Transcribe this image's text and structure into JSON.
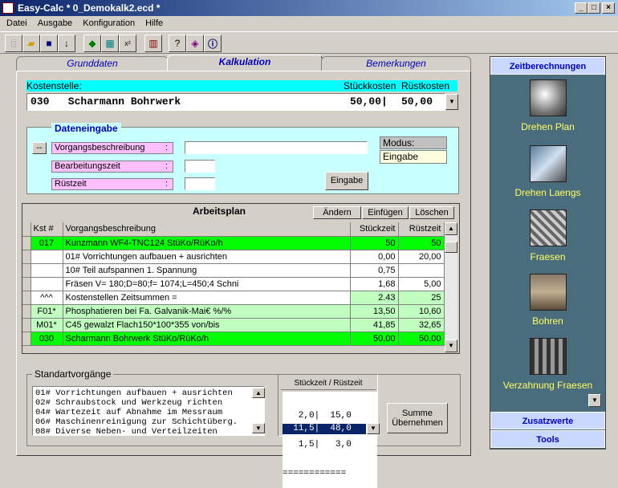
{
  "window": {
    "title": "Easy-Calc * 0_Demokalk2.ecd *",
    "min": "_",
    "max": "□",
    "close": "×"
  },
  "menu": [
    "Datei",
    "Ausgabe",
    "Konfiguration",
    "Hilfe"
  ],
  "toolbar_icons": [
    "new-file-icon",
    "open-folder-icon",
    "save-icon",
    "import-icon",
    "cube-icon",
    "calculator-icon",
    "formula-icon",
    "chart-icon",
    "help-icon",
    "book-icon",
    "info-icon"
  ],
  "tabs": [
    "Grunddaten",
    "Kalkulation",
    "Bemerkungen"
  ],
  "kostenstelle": {
    "label": "Kostenstelle:",
    "col2": "Stückkosten",
    "col3": "Rüstkosten",
    "value": "030   Scharmann Bohrwerk",
    "stk": "50,00|",
    "rst": "50,00"
  },
  "dateneingabe": {
    "title": "Dateneingabe",
    "btn_dots": "--",
    "f1": "Vorgangsbeschreibung",
    "f2": "Bearbeitungszeit",
    "f3": "Rüstzeit",
    "colon": ":",
    "modus_label": "Modus:",
    "modus_value": "Eingabe",
    "eingabe_button": "Eingabe"
  },
  "arbeitsplan": {
    "title": "Arbeitsplan",
    "btn_aendern": "Ändern",
    "btn_einfuegen": "Einfügen",
    "btn_loeschen": "Löschen",
    "headers": [
      "Kst #",
      "Vorgangsbeschreibung",
      "Stückzeit",
      "Rüstzeit"
    ],
    "rows": [
      {
        "k": "017",
        "d": "Kunzmann WF4-TNC124          StüKo/RüKo/h",
        "s": "50",
        "r": "50",
        "c": "g"
      },
      {
        "k": "",
        "d": "01# Vorrichtungen aufbauen + ausrichten",
        "s": "0,00",
        "r": "20,00",
        "c": "w"
      },
      {
        "k": "",
        "d": "10# Teil aufspannen 1. Spannung",
        "s": "0,75",
        "r": "",
        "c": "w"
      },
      {
        "k": "",
        "d": "Fräsen V= 180;D=80;f= 1074;L=450;4 Schni",
        "s": "1,68",
        "r": "5,00",
        "c": "w"
      },
      {
        "k": "^^^",
        "d": "    Kostenstellen Zeitsummen  =",
        "s": "2.43",
        "r": "25",
        "c": "w",
        "sc": "lg",
        "rc": "lg"
      },
      {
        "k": "F01*",
        "d": "Phosphatieren bei Fa. Galvanik-Mai€  %/%",
        "s": "13,50",
        "r": "10,60",
        "c": "lg"
      },
      {
        "k": "M01*",
        "d": "C45 gewalzt Flach150*100*355       von/bis",
        "s": "41,85",
        "r": "32,65",
        "c": "lg"
      },
      {
        "k": "030",
        "d": "Scharmann Bohrwerk                  StüKo/RüKo/h",
        "s": "50,00",
        "r": "50,00",
        "c": "g"
      }
    ]
  },
  "standard": {
    "title": "Standartvorgänge",
    "items": [
      "01# Vorrichtungen aufbauen + ausrichten",
      "02# Schraubstock und Werkzeug richten",
      "04# Wartezeit auf Abnahme im Messraum",
      "06# Maschinenreinigung zur Schichtüberg.",
      "08# Diverse Neben- und Verteilzeiten"
    ]
  },
  "zeiten": {
    "header": "Stückzeit / Rüstzeit",
    "lines": [
      "   2,0|  15,0",
      "   1,5|   3,0",
      "============"
    ],
    "selected": "  11,5|  48,0",
    "summe_button_1": "Summe",
    "summe_button_2": "Übernehmen"
  },
  "sidebar": {
    "head": "Zeitberechnungen",
    "items": [
      "Drehen Plan",
      "Drehen Laengs",
      "Fraesen",
      "Bohren",
      "Verzahnung Fraesen"
    ],
    "zusatz": "Zusatzwerte",
    "tools": "Tools"
  }
}
